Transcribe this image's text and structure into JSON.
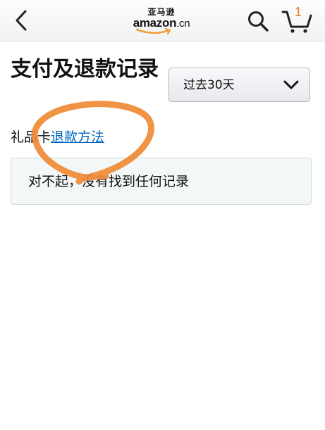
{
  "header": {
    "back_icon": "chevron-left-icon",
    "logo_cn": "亚马逊",
    "logo_en": "amazon",
    "logo_suffix": ".cn",
    "search_icon": "search-icon",
    "cart_icon": "cart-icon",
    "cart_count": "1"
  },
  "main": {
    "title": "支付及退款记录",
    "date_filter": {
      "selected": "过去30天",
      "icon": "chevron-down-icon"
    },
    "gift_card_text": "礼品卡",
    "refund_link": "退款方法",
    "no_records_message": "对不起，没有找到任何记录"
  },
  "colors": {
    "link": "#0066c0",
    "annotation": "#f08a35",
    "cart_count": "#e47911",
    "alert_border": "#c9dcdf",
    "alert_bg": "#f3f7f8"
  }
}
